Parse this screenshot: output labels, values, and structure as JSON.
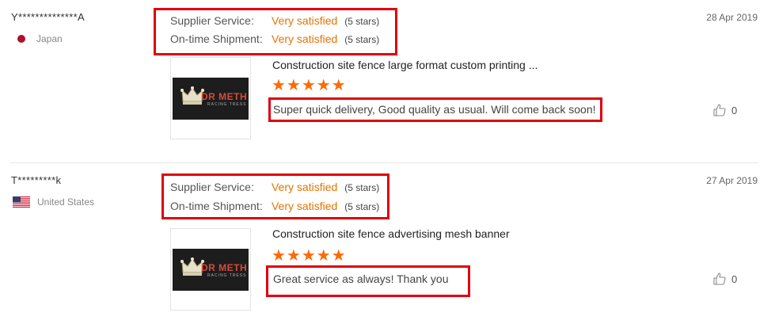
{
  "reviews": [
    {
      "buyer": "Y**************A",
      "country": "Japan",
      "date": "28 Apr 2019",
      "ratings": [
        {
          "label": "Supplier Service:",
          "value": "Very satisfied",
          "stars": "(5 stars)"
        },
        {
          "label": "On-time Shipment:",
          "value": "Very satisfied",
          "stars": "(5 stars)"
        }
      ],
      "product_title": "Construction site fence large format custom printing ...",
      "star_rating": 5,
      "stars_display": "★★★★★",
      "comment": "Super quick delivery, Good quality as usual. Will come back soon!",
      "helpful_count": "0",
      "thumb_logo": "DR METH",
      "thumb_logo_sub": "RACING TRESS"
    },
    {
      "buyer": "T*********k",
      "country": "United States",
      "date": "27 Apr 2019",
      "ratings": [
        {
          "label": "Supplier Service:",
          "value": "Very satisfied",
          "stars": "(5 stars)"
        },
        {
          "label": "On-time Shipment:",
          "value": "Very satisfied",
          "stars": "(5 stars)"
        }
      ],
      "product_title": "Construction site fence advertising mesh banner",
      "star_rating": 5,
      "stars_display": "★★★★★",
      "comment": "Great service as always! Thank you",
      "helpful_count": "0",
      "thumb_logo": "DR METH",
      "thumb_logo_sub": "RACING TRESS"
    }
  ],
  "colors": {
    "accent_orange": "#e67300",
    "star_orange": "#ff6a00",
    "highlight_red": "#e0000f"
  }
}
